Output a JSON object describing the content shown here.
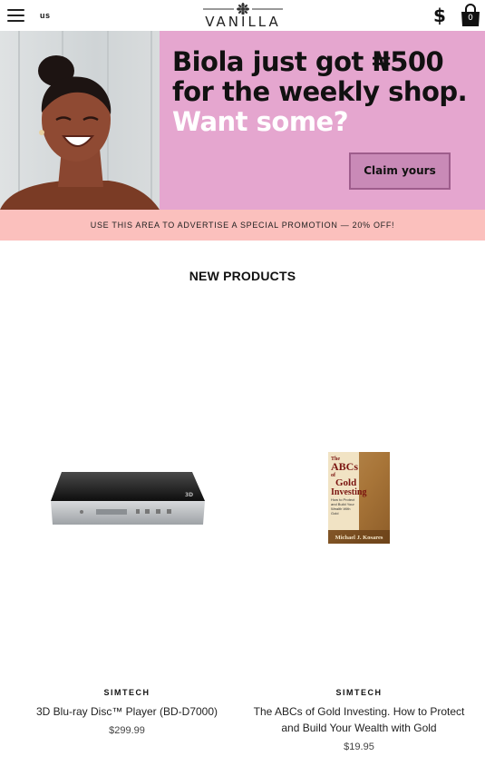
{
  "header": {
    "menu_icon": "hamburger-menu-icon",
    "locale": "us",
    "logo_text": "VANILLA",
    "logo_icon": "vanilla-flower-icon",
    "currency_symbol": "$",
    "cart_icon": "shopping-bag-icon",
    "cart_count": "0"
  },
  "banner": {
    "headline_line1": "Biola just got ₦500",
    "headline_line2": "for the weekly shop.",
    "headline_line3": "Want some?",
    "button_label": "Claim yours",
    "background_color": "#e5a6cf"
  },
  "promo": {
    "text": "USE THIS AREA TO ADVERTISE A SPECIAL PROMOTION — 20% OFF!",
    "background_color": "#fbc0bd"
  },
  "section": {
    "title": "NEW PRODUCTS"
  },
  "products": [
    {
      "brand": "SIMTECH",
      "name": "3D Blu-ray Disc™ Player (BD-D7000)",
      "price": "$299.99",
      "image": "blu-ray-player-image",
      "image_text": "3D"
    },
    {
      "brand": "SIMTECH",
      "name": "The ABCs of Gold Investing. How to Protect and Build Your Wealth with Gold",
      "price": "$19.95",
      "image": "book-cover-image",
      "cover_title_1": "The",
      "cover_title_2": "ABCs",
      "cover_title_3": "of",
      "cover_title_4": "Gold",
      "cover_title_5": "Investing",
      "cover_subtitle": "How to Protect and Build Your Wealth With Gold",
      "cover_author": "Michael J. Kosares"
    }
  ]
}
